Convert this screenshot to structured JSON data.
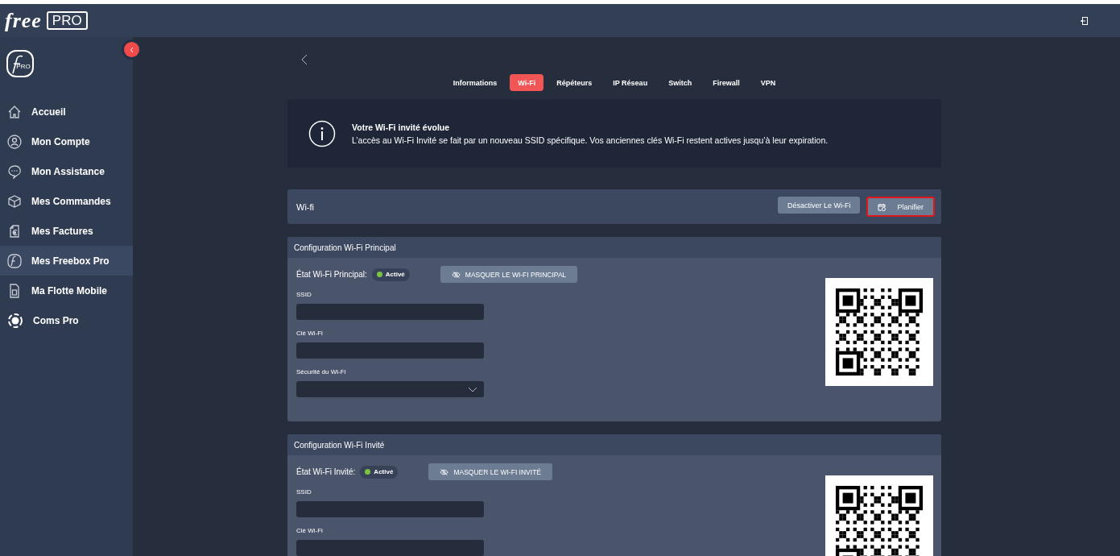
{
  "header": {
    "logo_word": "free",
    "logo_badge": "PRO"
  },
  "sidebar": {
    "logo_badge": "PRO",
    "items": [
      {
        "label": "Accueil",
        "selected": false
      },
      {
        "label": "Mon Compte",
        "selected": false
      },
      {
        "label": "Mon Assistance",
        "selected": false
      },
      {
        "label": "Mes Commandes",
        "selected": false
      },
      {
        "label": "Mes Factures",
        "selected": false
      },
      {
        "label": "Mes Freebox Pro",
        "selected": true
      },
      {
        "label": "Ma Flotte Mobile",
        "selected": false
      },
      {
        "label": "Coms Pro",
        "selected": false
      }
    ]
  },
  "tabs": [
    {
      "label": "Informations",
      "selected": false
    },
    {
      "label": "Wi-Fi",
      "selected": true
    },
    {
      "label": "Répéteurs",
      "selected": false
    },
    {
      "label": "IP Réseau",
      "selected": false
    },
    {
      "label": "Switch",
      "selected": false
    },
    {
      "label": "Firewall",
      "selected": false
    },
    {
      "label": "VPN",
      "selected": false
    }
  ],
  "notice": {
    "title": "Votre Wi-Fi invité évolue",
    "text": "L’accès au Wi-Fi Invité se fait par un nouveau SSID spécifique. Vos anciennes clés Wi-Fi restent actives jusqu’à leur expiration."
  },
  "wifi_bar": {
    "title": "Wi-fi",
    "buttons": [
      {
        "label": "Désactiver Le Wi-Fi",
        "highlighted": false,
        "icon": false
      },
      {
        "label": "Planifier",
        "highlighted": true,
        "icon": true
      }
    ]
  },
  "sections": [
    {
      "title": "Configuration Wi-Fi Principal",
      "state_label": "État Wi-Fi Principal:",
      "status": "Activé",
      "active": true,
      "hide_button": "MASQUER LE WI-FI PRINCIPAL",
      "fields": [
        {
          "label": "SSID",
          "kind": "text"
        },
        {
          "label": "Clé Wi-Fi",
          "kind": "text"
        },
        {
          "label": "Sécurité du Wi-Fi",
          "kind": "select"
        }
      ]
    },
    {
      "title": "Configuration Wi-Fi Invité",
      "state_label": "État Wi-Fi Invité:",
      "status": "Activé",
      "active": true,
      "hide_button": "MASQUER LE WI-FI INVITÉ",
      "fields": [
        {
          "label": "SSID",
          "kind": "text"
        },
        {
          "label": "Clé Wi-Fi",
          "kind": "text"
        }
      ]
    }
  ]
}
